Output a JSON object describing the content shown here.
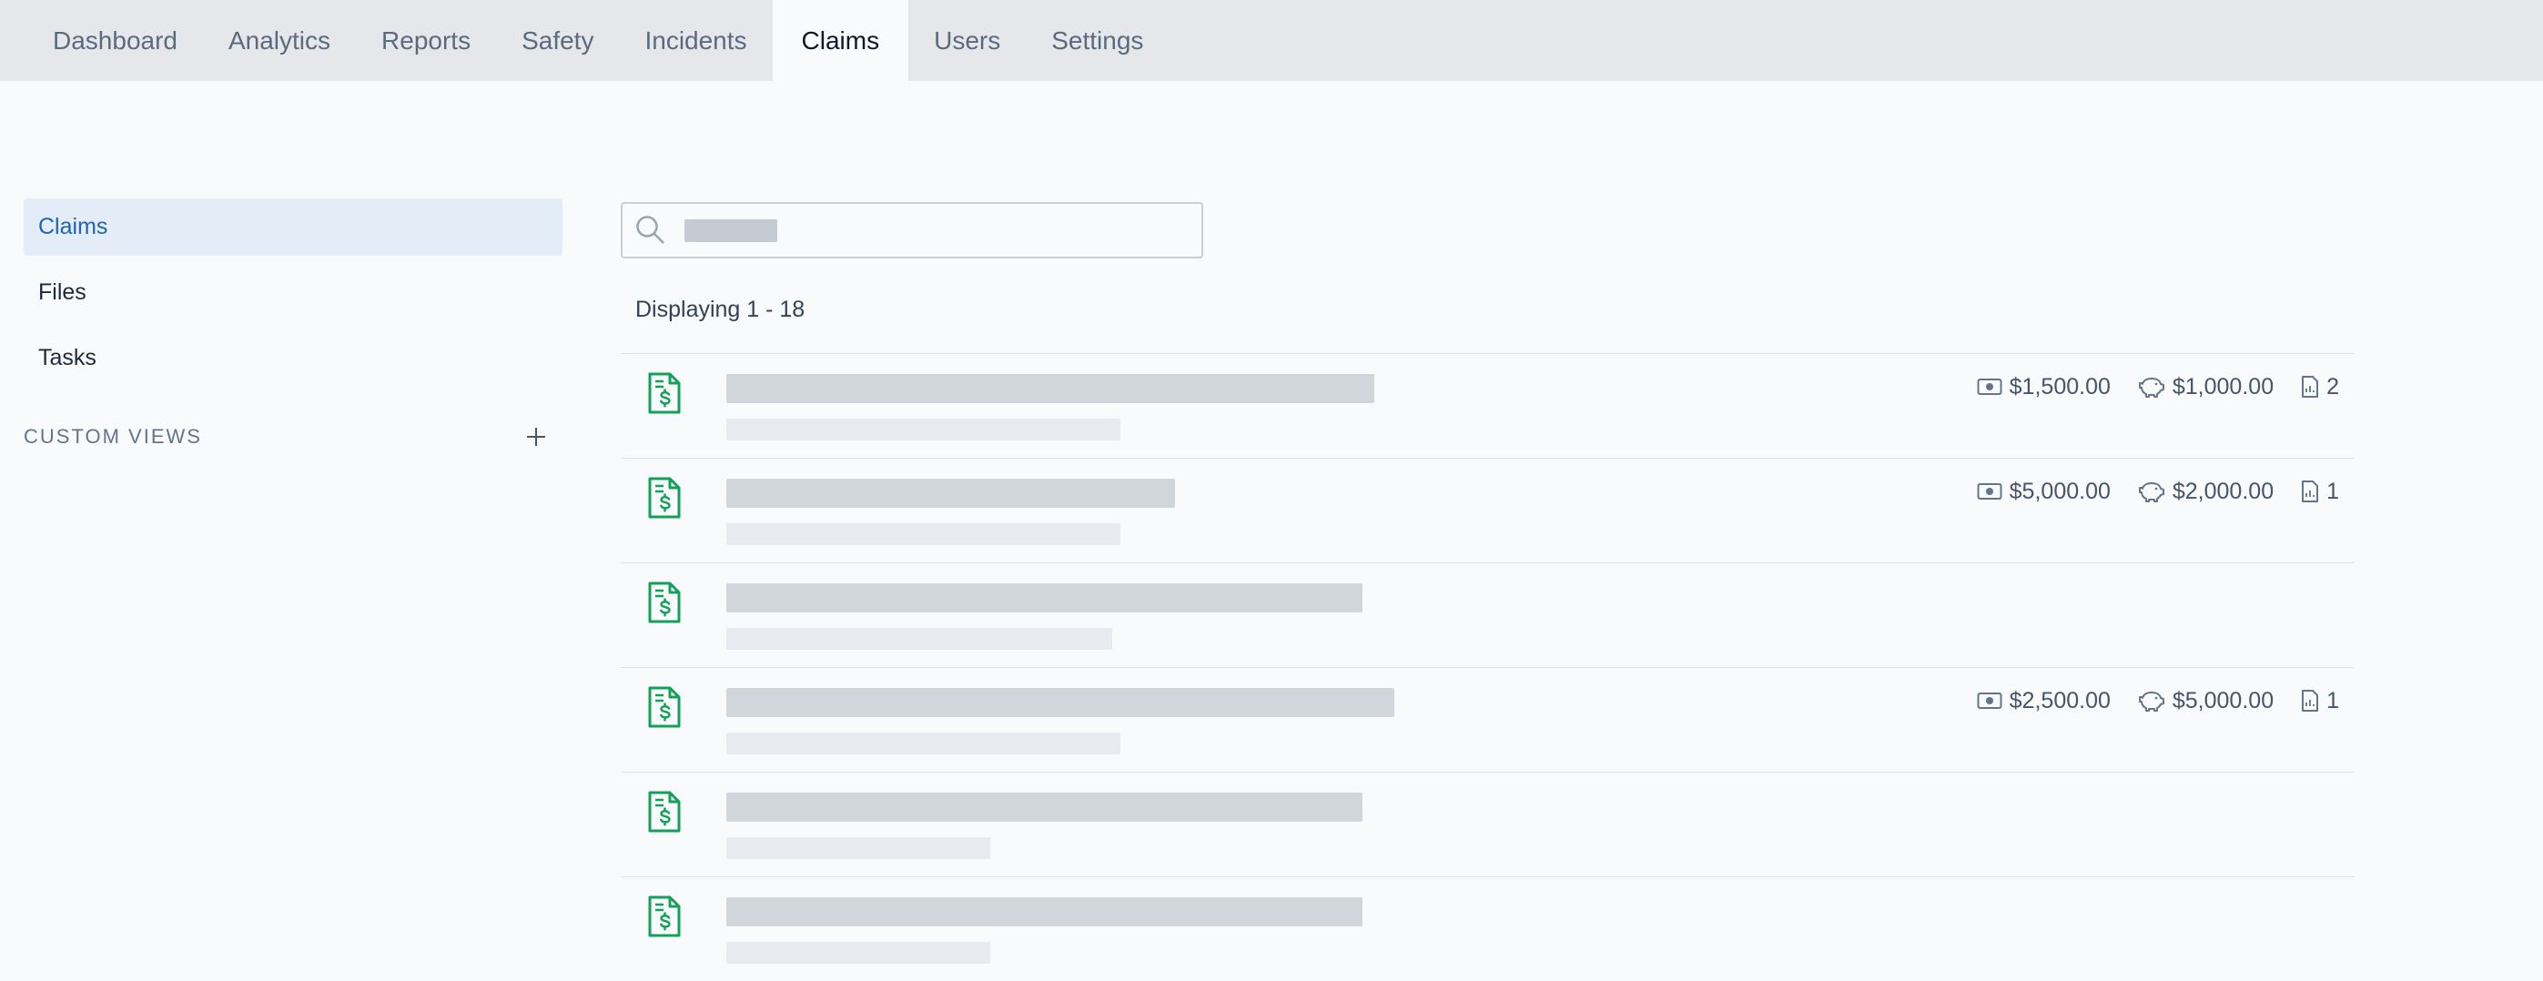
{
  "tabs": [
    "Dashboard",
    "Analytics",
    "Reports",
    "Safety",
    "Incidents",
    "Claims",
    "Users",
    "Settings"
  ],
  "sidebar": {
    "items": [
      "Claims",
      "Files",
      "Tasks"
    ],
    "custom_views_label": "CUSTOM VIEWS"
  },
  "search": {
    "value": ""
  },
  "displaying": "Displaying 1 - 18",
  "icons": {
    "claim": "claim-document-icon",
    "paid": "money-icon",
    "reserve": "piggy-bank-icon",
    "files": "file-icon",
    "search": "search-icon",
    "add": "plus-icon"
  },
  "colors": {
    "accent": "#1d64b3",
    "claim_icon": "#15a05a"
  },
  "claims": [
    {
      "paid": "$1,500.00",
      "reserve": "$1,000.00",
      "files": "2"
    },
    {
      "paid": "$5,000.00",
      "reserve": "$2,000.00",
      "files": "1"
    },
    {
      "paid": "",
      "reserve": "",
      "files": ""
    },
    {
      "paid": "$2,500.00",
      "reserve": "$5,000.00",
      "files": "1"
    },
    {
      "paid": "",
      "reserve": "",
      "files": ""
    },
    {
      "paid": "",
      "reserve": "",
      "files": ""
    }
  ]
}
